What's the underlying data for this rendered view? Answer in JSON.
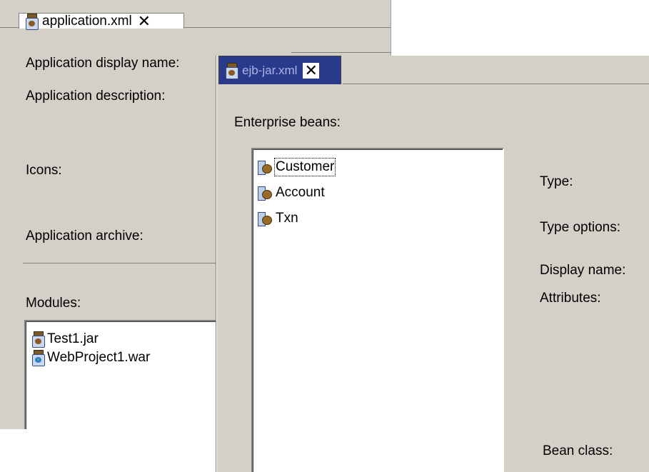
{
  "application_editor": {
    "tab_title": "application.xml",
    "close_glyph": "✕",
    "labels": {
      "display_name": "Application display name:",
      "description": "Application description:",
      "icons": "Icons:",
      "archive": "Application archive:",
      "modules": "Modules:"
    },
    "modules": [
      {
        "name": "Test1.jar",
        "icon": "jar-icon"
      },
      {
        "name": "WebProject1.war",
        "icon": "war-icon"
      }
    ]
  },
  "ejb_editor": {
    "tab_title": "ejb-jar.xml",
    "close_glyph": "✕",
    "labels": {
      "enterprise_beans": "Enterprise beans:",
      "type": "Type:",
      "type_options": "Type options:",
      "display_name": "Display name:",
      "attributes": "Attributes:",
      "bean_class": "Bean class:"
    },
    "beans": [
      {
        "name": "Customer",
        "icon": "bean-icon",
        "selected": true
      },
      {
        "name": "Account",
        "icon": "bean-icon"
      },
      {
        "name": "Txn",
        "icon": "bean-icon"
      }
    ]
  },
  "colors": {
    "window_bg": "#d4d0c8",
    "active_tab_bg": "#2a3a8a",
    "list_bg": "#ffffff"
  }
}
